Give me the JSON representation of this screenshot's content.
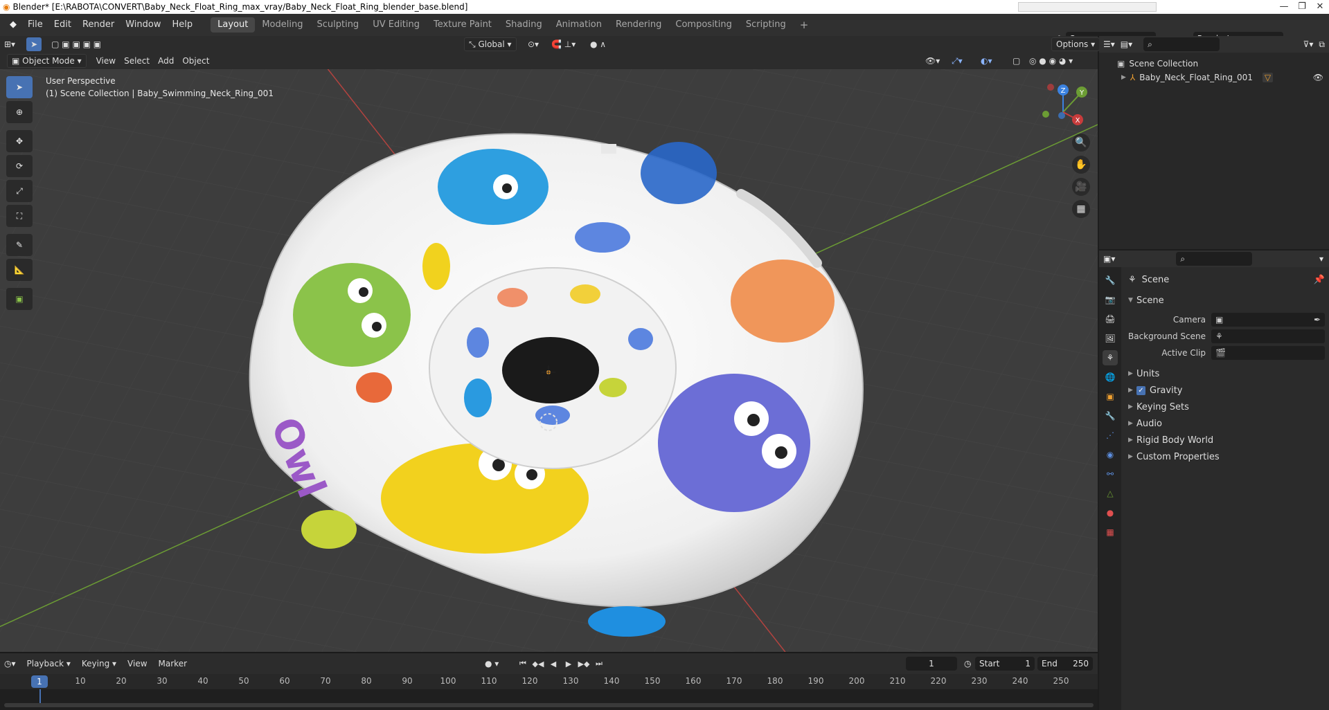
{
  "window": {
    "title": "Blender* [E:\\RABOTA\\CONVERT\\Baby_Neck_Float_Ring_max_vray/Baby_Neck_Float_Ring_blender_base.blend]"
  },
  "menu": {
    "items": [
      "File",
      "Edit",
      "Render",
      "Window",
      "Help"
    ]
  },
  "workspaces": {
    "tabs": [
      "Layout",
      "Modeling",
      "Sculpting",
      "UV Editing",
      "Texture Paint",
      "Shading",
      "Animation",
      "Rendering",
      "Compositing",
      "Scripting"
    ],
    "active": "Layout"
  },
  "scene_selector": {
    "scene": "Scene",
    "render_layer": "RenderLayer"
  },
  "viewport_header": {
    "transform_orientation": "Global",
    "options_label": "Options",
    "mode": "Object Mode",
    "menus": [
      "View",
      "Select",
      "Add",
      "Object"
    ]
  },
  "viewport": {
    "perspective_label": "User Perspective",
    "collection_label": "(1) Scene Collection | Baby_Swimming_Neck_Ring_001",
    "gizmo": {
      "x": "X",
      "y": "Y",
      "z": "Z"
    },
    "colors": {
      "bg": "#3d3d3d",
      "grid": "#494949",
      "x_axis": "#b3433f",
      "y_axis": "#6c9d34",
      "selected": "#4772b3"
    }
  },
  "outliner": {
    "root": "Scene Collection",
    "items": [
      {
        "name": "Baby_Neck_Float_Ring_001"
      }
    ]
  },
  "properties": {
    "header": "Scene",
    "section": "Scene",
    "rows": [
      {
        "label": "Camera",
        "value": ""
      },
      {
        "label": "Background Scene",
        "value": ""
      },
      {
        "label": "Active Clip",
        "value": ""
      }
    ],
    "subsections": [
      {
        "label": "Units",
        "checked": null
      },
      {
        "label": "Gravity",
        "checked": true
      },
      {
        "label": "Keying Sets",
        "checked": null
      },
      {
        "label": "Audio",
        "checked": null
      },
      {
        "label": "Rigid Body World",
        "checked": null
      },
      {
        "label": "Custom Properties",
        "checked": null
      }
    ]
  },
  "timeline": {
    "menus": [
      "Playback",
      "Keying",
      "View",
      "Marker"
    ],
    "current_frame": "1",
    "start_label": "Start",
    "start": "1",
    "end_label": "End",
    "end": "250",
    "ruler_current": "1",
    "ticks": [
      "10",
      "20",
      "30",
      "40",
      "50",
      "60",
      "70",
      "80",
      "90",
      "100",
      "110",
      "120",
      "130",
      "140",
      "150",
      "160",
      "170",
      "180",
      "190",
      "200",
      "210",
      "220",
      "230",
      "240",
      "250"
    ]
  }
}
